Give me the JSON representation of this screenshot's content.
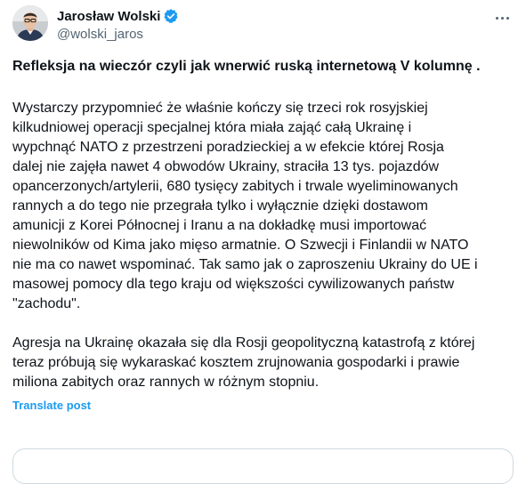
{
  "author": {
    "display_name": "Jarosław Wolski",
    "handle": "@wolski_jaros",
    "avatar_icon": "profile-photo",
    "verified": true,
    "verified_color": "#1d9bf0"
  },
  "more_icon": "more-horizontal-icon",
  "post": {
    "title": "Refleksja na wieczór czyli jak wnerwić ruską internetową V kolumnę .",
    "paragraph1_lines": [
      "Wystarczy przypomnieć że właśnie kończy się trzeci rok rosyjskiej",
      "kilkudniowej operacji specjalnej która miała zająć całą Ukrainę i",
      "wypchnąć NATO z przestrzeni poradzieckiej a w efekcie której Rosja",
      "dalej nie zajęła nawet 4 obwodów Ukrainy, straciła 13 tys. pojazdów",
      "opancerzonych/artylerii, 680 tysięcy zabitych i trwale wyeliminowanych",
      "rannych a do tego nie przegrała tylko i wyłącznie dzięki dostawom",
      "amunicji z Korei Północnej i Iranu a na dokładkę musi importować",
      "niewolników od Kima jako mięso armatnie.  O Szwecji i Finlandii w NATO",
      "nie ma co nawet wspominać. Tak samo jak o zaproszeniu Ukrainy do UE i",
      "masowej pomocy dla tego kraju od większości cywilizowanych państw",
      "\"zachodu\"."
    ],
    "paragraph2_lines": [
      "Agresja na Ukrainę okazała się dla Rosji geopolityczną katastrofą z której",
      "teraz próbują się wykaraskać  kosztem zrujnowania gospodarki i prawie",
      "miliona zabitych oraz rannych w różnym stopniu."
    ],
    "translate_label": "Translate post"
  },
  "colors": {
    "text": "#0f1419",
    "secondary": "#536471",
    "accent": "#1d9bf0",
    "border": "#cfd9de"
  }
}
